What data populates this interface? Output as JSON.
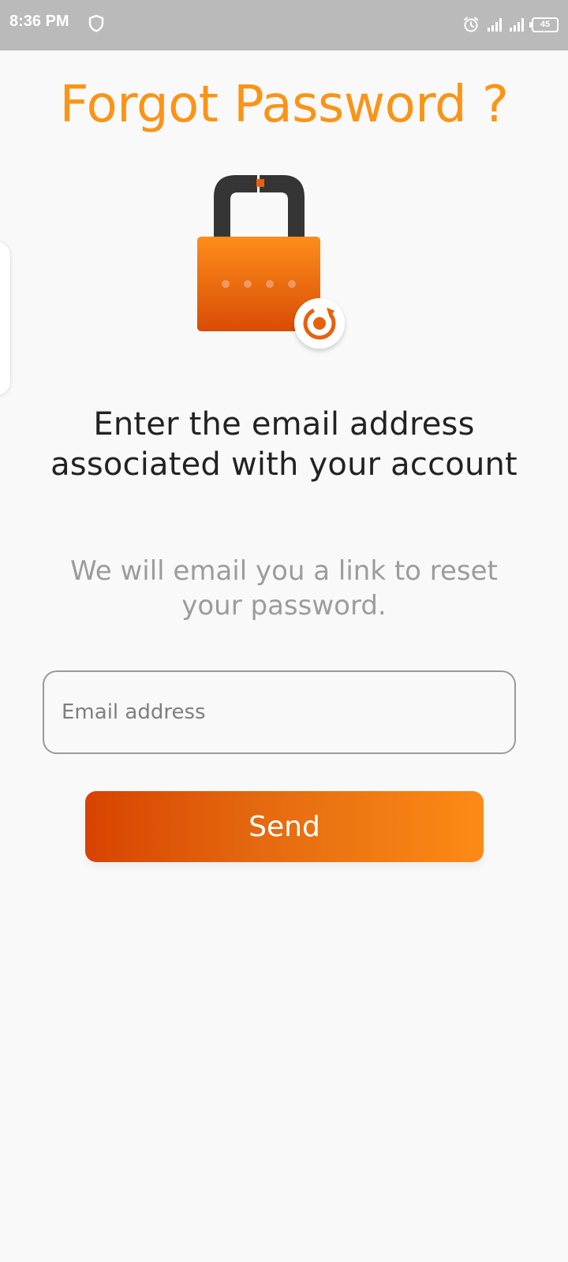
{
  "status_bar": {
    "time": "8:36 PM",
    "battery": "45",
    "icons": [
      "shield-icon",
      "alarm-icon",
      "signal-icon",
      "signal-icon",
      "battery-icon"
    ]
  },
  "page": {
    "title": "Forgot Password ?",
    "illustration": "lock-reset-icon",
    "heading": "Enter the email address associated with your account",
    "subtext": "We will email you a link to reset your password."
  },
  "form": {
    "email_placeholder": "Email address",
    "email_value": "",
    "send_label": "Send"
  },
  "colors": {
    "accent": "#fa9417",
    "button_gradient_start": "#d84300",
    "button_gradient_end": "#fd8a15",
    "status_bar": "#bababa"
  }
}
